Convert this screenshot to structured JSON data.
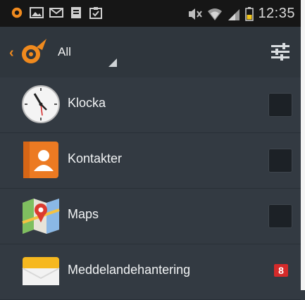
{
  "status_bar": {
    "time": "12:35",
    "left_icons": [
      "avast-notification-icon",
      "image-icon",
      "mail-icon",
      "document-icon",
      "clipboard-check-icon"
    ],
    "right_icons": [
      "mute-icon",
      "wifi-icon",
      "signal-icon",
      "battery-icon"
    ]
  },
  "action_bar": {
    "filter_label": "All",
    "logo_icon": "avast-logo-icon",
    "settings_icon": "sliders-icon"
  },
  "apps": [
    {
      "label": "Klocka",
      "icon": "clock-icon"
    },
    {
      "label": "Kontakter",
      "icon": "contacts-icon"
    },
    {
      "label": "Maps",
      "icon": "maps-icon"
    },
    {
      "label": "Meddelandehantering",
      "icon": "messages-icon"
    }
  ],
  "badge": "8",
  "colors": {
    "background": "#333a42",
    "status_bar": "#161616",
    "accent_orange": "#f08a1e",
    "badge_red": "#d52a2a"
  }
}
